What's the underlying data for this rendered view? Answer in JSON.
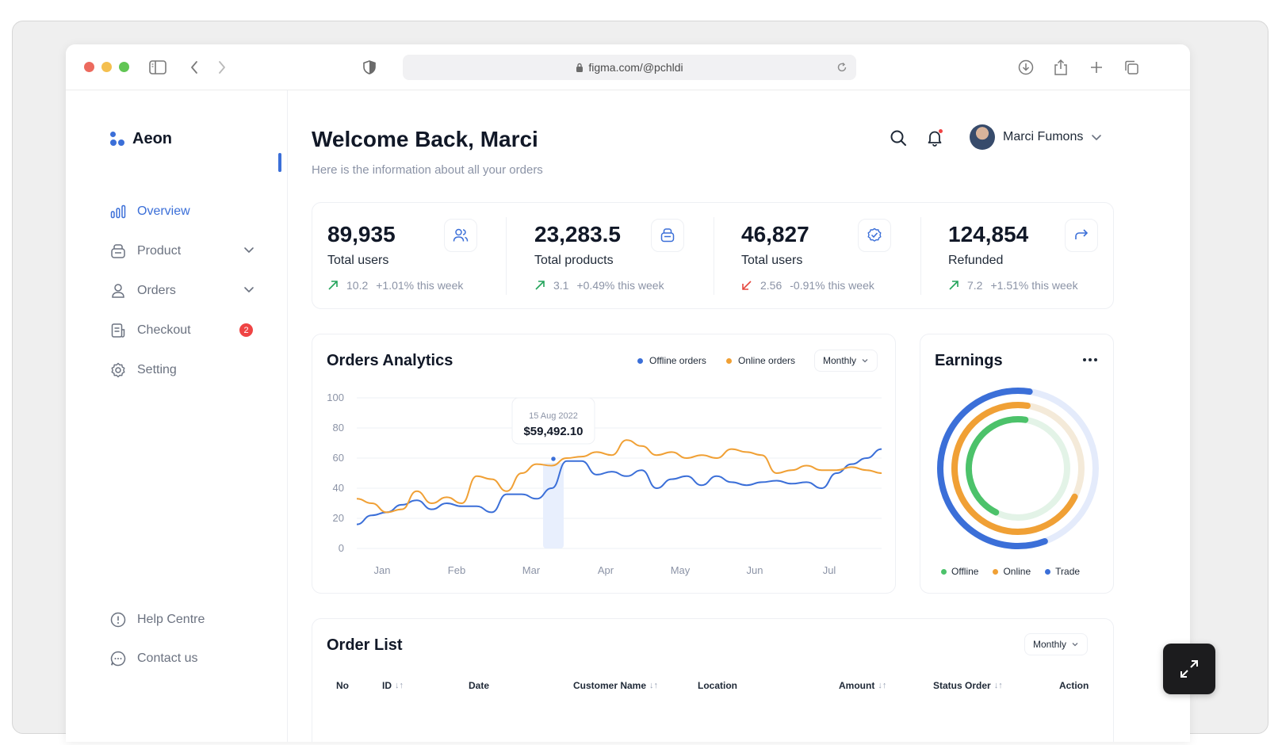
{
  "browser": {
    "url": "figma.com/@pchldi"
  },
  "brand": {
    "name": "Aeon",
    "accent": "#3b6fd8"
  },
  "sidebar": {
    "items": [
      {
        "label": "Overview",
        "icon": "bar-chart-icon"
      },
      {
        "label": "Product",
        "icon": "box-icon"
      },
      {
        "label": "Orders",
        "icon": "user-icon"
      },
      {
        "label": "Checkout",
        "icon": "receipt-icon",
        "badge": "2"
      },
      {
        "label": "Setting",
        "icon": "gear-icon"
      }
    ],
    "footer": [
      {
        "label": "Help Centre",
        "icon": "info-icon"
      },
      {
        "label": "Contact us",
        "icon": "chat-icon"
      }
    ]
  },
  "header": {
    "title": "Welcome Back, Marci",
    "subtitle": "Here is the information about all your orders",
    "user_name": "Marci Fumons"
  },
  "stats": [
    {
      "value": "89,935",
      "label": "Total users",
      "trend_value": "10.2",
      "trend_text": "+1.01% this week",
      "direction": "up",
      "icon": "users-icon"
    },
    {
      "value": "23,283.5",
      "label": "Total products",
      "trend_value": "3.1",
      "trend_text": "+0.49% this week",
      "direction": "up",
      "icon": "box-icon"
    },
    {
      "value": "46,827",
      "label": "Total users",
      "trend_value": "2.56",
      "trend_text": "-0.91% this week",
      "direction": "down",
      "icon": "check-circle-icon"
    },
    {
      "value": "124,854",
      "label": "Refunded",
      "trend_value": "7.2",
      "trend_text": "+1.51% this week",
      "direction": "up",
      "icon": "share-icon"
    }
  ],
  "analytics": {
    "title": "Orders Analytics",
    "legend_offline": "Offline orders",
    "legend_online": "Online orders",
    "period": "Monthly",
    "tooltip_date": "15 Aug 2022",
    "tooltip_value": "$59,492.10"
  },
  "chart_data": {
    "type": "line",
    "x": [
      "Jan",
      "Feb",
      "Mar",
      "Apr",
      "May",
      "Jun",
      "Jul"
    ],
    "ylim": [
      0,
      100
    ],
    "yticks": [
      "100",
      "80",
      "60",
      "40",
      "20",
      "0"
    ],
    "grid": true,
    "colors": {
      "offline": "#3b6fd8",
      "online": "#f0a035"
    },
    "series": [
      {
        "name": "Offline orders",
        "color": "#3b6fd8",
        "values": [
          16,
          22,
          24,
          29,
          32,
          26,
          30,
          28,
          28,
          24,
          36,
          36,
          33,
          40,
          58,
          58,
          49,
          51,
          48,
          52,
          40,
          46,
          48,
          42,
          48,
          44,
          42,
          44,
          45,
          43,
          44,
          40,
          50,
          56,
          60,
          66
        ]
      },
      {
        "name": "Online orders",
        "color": "#f0a035",
        "values": [
          33,
          30,
          24,
          26,
          38,
          30,
          34,
          30,
          48,
          46,
          38,
          50,
          56,
          55,
          60,
          61,
          64,
          62,
          72,
          68,
          62,
          64,
          60,
          62,
          60,
          66,
          64,
          62,
          50,
          52,
          55,
          52,
          52,
          54,
          52,
          50
        ]
      }
    ],
    "highlight": {
      "label": "15 Aug 2022",
      "value": "$59,492.10"
    }
  },
  "earnings": {
    "title": "Earnings",
    "legend": [
      {
        "label": "Offline",
        "color": "#4cc26a"
      },
      {
        "label": "Online",
        "color": "#f0a035"
      },
      {
        "label": "Trade",
        "color": "#3b6fd8"
      }
    ],
    "rings": [
      {
        "name": "Trade",
        "fraction": 0.58,
        "color": "#3b6fd8"
      },
      {
        "name": "Online",
        "fraction": 0.7,
        "color": "#f0a035"
      },
      {
        "name": "Offline",
        "fraction": 0.45,
        "color": "#4cc26a"
      }
    ]
  },
  "order_list": {
    "title": "Order List",
    "period": "Monthly",
    "columns": [
      "No",
      "ID",
      "Date",
      "Customer Name",
      "Location",
      "Amount",
      "Status Order",
      "Action"
    ]
  }
}
